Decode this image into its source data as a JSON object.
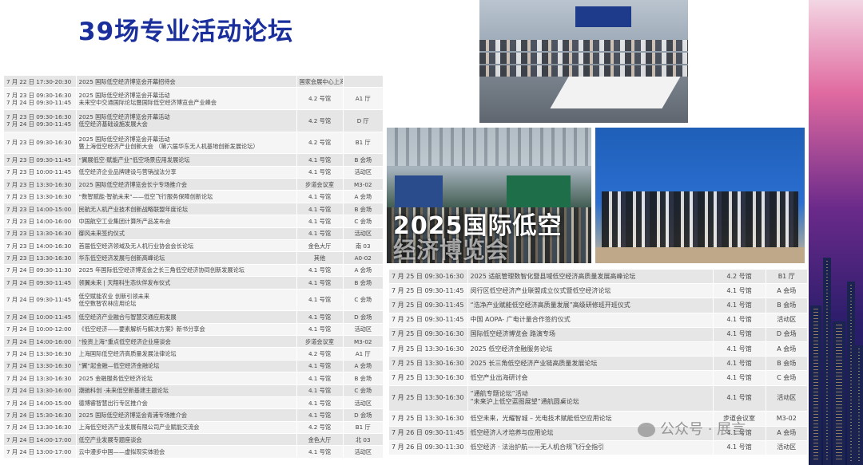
{
  "title": "39场专业活动论坛",
  "left_schedule": [
    [
      "7 月 22 日 17:30-20:30",
      "2025 国际低空经济博览会开幕招待会",
      "国家会展中心上海洲际酒店",
      ""
    ],
    [
      "7 月 23 日 09:30-16:30\n7 月 24 日 09:30-11:45",
      "2025 国际低空经济博览会开幕活动\n未来空中交通国际论坛暨国际低空经济博览会产业峰会",
      "4.2 号馆",
      "A1 厅"
    ],
    [
      "7 月 23 日 09:30-16:30\n7 月 24 日 09:30-11:45",
      "2025 国际低空经济博览会开幕活动\n低空经济基础设施发展大会",
      "4.2 号馆",
      "D 厅"
    ],
    [
      "7 月 23 日 09:30-16:30",
      "2025 国际低空经济博览会开幕活动\n暨上海低空经济产业创新大会 （第六届华东无人机基地创新发展论坛）",
      "4.2 号馆",
      "B1 厅"
    ],
    [
      "7 月 23 日 09:30-11:45",
      "“翼展低空·赋能产业”低空场景应用发展论坛",
      "4.1 号馆",
      "B 会场"
    ],
    [
      "7 月 23 日 10:00-11:45",
      "低空经济企业品牌建设与营销战法分享",
      "4.1 号馆",
      "活动区"
    ],
    [
      "7 月 23 日 13:30-16:30",
      "2025 国际低空经济博览会长宁专场推介会",
      "步道会议室",
      "M3-02"
    ],
    [
      "7 月 23 日 13:30-16:30",
      "“数智赋能·智航未来”——低空飞行服务保障创新论坛",
      "4.1 号馆",
      "A 会场"
    ],
    [
      "7 月 23 日 14:00-15:00",
      "民航无人机产业技术创新战略联盟年度论坛",
      "4.1 号馆",
      "B 会场"
    ],
    [
      "7 月 23 日 14:00-16:00",
      "中国航空工业集团计算所产品发布会",
      "4.1 号馆",
      "C 会场"
    ],
    [
      "7 月 23 日 13:30-16:30",
      "御风未来签约仪式",
      "4.1 号馆",
      "活动区"
    ],
    [
      "7 月 23 日 14:00-16:30",
      "首届低空经济领域及无人机行业协会会长论坛",
      "金色大厅",
      "南 03"
    ],
    [
      "7 月 23 日 13:30-16:30",
      "华东低空经济发展与创新高峰论坛",
      "其他",
      "A0-02"
    ],
    [
      "7 月 24 日 09:30-11:30",
      "2025 年国际低空经济博览会之长三角低空经济协同创新发展论坛",
      "4.1 号馆",
      "A 会场"
    ],
    [
      "7 月 24 日 09:30-11:45",
      "领翼未来 | 天翔科生态伙伴发布仪式",
      "4.1 号馆",
      "B 会场"
    ],
    [
      "7 月 24 日 09:30-11:45",
      "低空赋能农业 创新引领未来\n低空数智农林应用论坛",
      "4.1 号馆",
      "C 会场"
    ],
    [
      "7 月 24 日 10:00-11:45",
      "低空经济产业融合与智慧交通应用发展",
      "4.1 号馆",
      "D 会场"
    ],
    [
      "7 月 24 日 10:00-12:00",
      "《低空经济——要素解析与解决方案》新书分享会",
      "4.1 号馆",
      "活动区"
    ],
    [
      "7 月 24 日 14:00-16:00",
      "“投资上海”重点低空经济企业座谈会",
      "步道会议室",
      "M3-02"
    ],
    [
      "7 月 24 日 13:30-16:30",
      "上海国际低空经济高质量发展法律论坛",
      "4.2 号馆",
      "A1 厅"
    ],
    [
      "7 月 24 日 13:30-16:30",
      "“翼”起金融—低空经济金融论坛",
      "4.1 号馆",
      "A 会场"
    ],
    [
      "7 月 24 日 13:30-16:30",
      "2025 金融服务低空经济论坛",
      "4.1 号馆",
      "B 会场"
    ],
    [
      "7 月 24 日 13:30-16:00",
      "潮驰科创 ·未来低空新基建主题论坛",
      "4.1 号馆",
      "C 会场"
    ],
    [
      "7 月 24 日 14:00-15:00",
      "德博睿智慧出行专区推介会",
      "4.1 号馆",
      "活动区"
    ],
    [
      "7 月 24 日 15:30-16:30",
      "2025 国际低空经济博览会青浦专场推介会",
      "4.1 号馆",
      "D 会场"
    ],
    [
      "7 月 24 日 13:30-16:30",
      "上海低空经济产业发展有限公司产业赋能交流会",
      "4.2 号馆",
      "B1 厅"
    ],
    [
      "7 月 24 日 14:00-17:00",
      "低空产业发展专题座谈会",
      "金色大厅",
      "北 03"
    ],
    [
      "7 月 24 日 13:00-17:00",
      "云中漫步中国——虚拟现实体验会",
      "4.1 号馆",
      "活动区"
    ]
  ],
  "right_schedule": [
    [
      "7 月 25 日 09:30-16:30",
      "2025 适航管理数智化暨县域低空经济高质量发展高峰论坛",
      "4.2 号馆",
      "B1 厅"
    ],
    [
      "7 月 25 日 09:30-11:45",
      "闵行区低空经济产业联盟成立仪式暨低空经济论坛",
      "4.1 号馆",
      "A 会场"
    ],
    [
      "7 月 25 日 09:30-11:45",
      "“浩净产业赋能低空经济高质量发展”高级研修班开班仪式",
      "4.1 号馆",
      "B 会场"
    ],
    [
      "7 月 25 日 09:30-11:45",
      "中国 AOPA- 广电计量合作签约仪式",
      "4.1 号馆",
      "活动区"
    ],
    [
      "7 月 25 日 09:30-16:30",
      "国际低空经济博览会 路演专场",
      "4.1 号馆",
      "D 会场"
    ],
    [
      "7 月 25 日 13:30-16:30",
      "2025 低空经济金融服务论坛",
      "4.1 号馆",
      "A 会场"
    ],
    [
      "7 月 25 日 13:30-16:30",
      "2025 长三角低空经济产业链高质量发展论坛",
      "4.1 号馆",
      "B 会场"
    ],
    [
      "7 月 25 日 13:30-16:30",
      "低空产业出海研讨会",
      "4.1 号馆",
      "C 会场"
    ],
    [
      "7 月 25 日 13:30-16:30",
      "“通航专题论坛”活动\n“未来沪上低空蓝图展望”通航圆桌论坛",
      "4.1 号馆",
      "活动区"
    ],
    [
      "7 月 25 日 13:30-16:30",
      "低空未来，光耀智城 – 光电技术赋能低空应用论坛",
      "步道会议室",
      "M3-02"
    ],
    [
      "7 月 26 日 09:30-11:45",
      "低空经济人才培养与应用论坛",
      "4.1 号馆",
      "A 会场"
    ],
    [
      "7 月 26 日 09:30-11:30",
      "低空经济 · 法治护航——无人机合规飞行全指引",
      "4.1 号馆",
      "活动区"
    ]
  ],
  "photo_overlay": [
    "2025国际低空",
    "经济博览会"
  ],
  "watermark": "公众号 · 展言",
  "colors": {
    "title": "#1a2f9c",
    "row_odd": "#e6e6e6",
    "row_even": "#f5f5f5"
  }
}
